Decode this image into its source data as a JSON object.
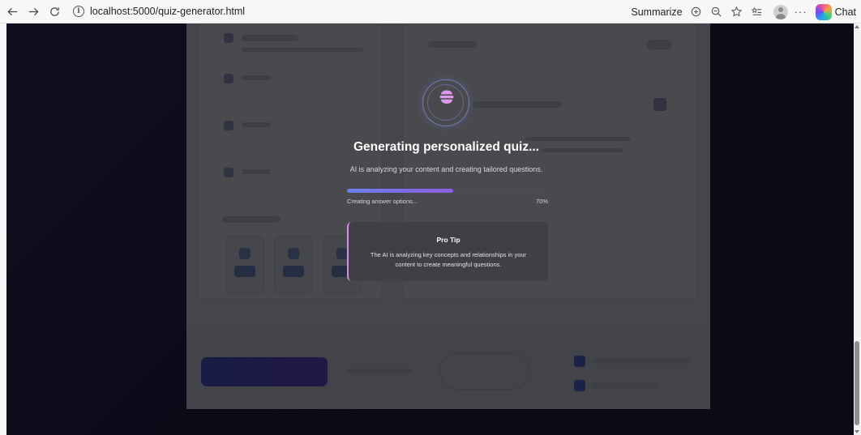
{
  "browser": {
    "url": "localhost:5000/quiz-generator.html",
    "summarize_label": "Summarize",
    "more_label": "···",
    "chat_label": "Chat",
    "icons": [
      "back-arrow-icon",
      "forward-arrow-icon",
      "refresh-icon",
      "site-info-icon",
      "summarize-icon",
      "zoom-icon",
      "favorite-star-icon",
      "favorites-list-icon",
      "profile-avatar",
      "more-dots-icon",
      "copilot-icon"
    ]
  },
  "loader": {
    "title": "Generating personalized quiz...",
    "subtitle": "AI is analyzing your content and creating tailored questions.",
    "progress": {
      "status": "Creating answer options...",
      "percent_label": "70%",
      "value": 0.7,
      "fill_visible_fraction": 0.53
    },
    "tip": {
      "title": "Pro Tip",
      "body": "The AI is analyzing key concepts and relationships in your content to create meaningful questions."
    },
    "icon": "brain-icon"
  },
  "colors": {
    "accent": "#6d7ef0",
    "accent_secondary": "#8c5fe6",
    "tip_border": "#d98be8",
    "overlay_bg": "#1a1238"
  }
}
